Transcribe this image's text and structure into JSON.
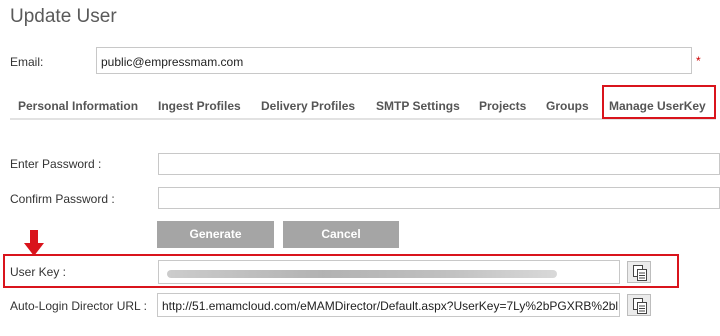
{
  "page": {
    "title": "Update User"
  },
  "email": {
    "label": "Email:",
    "value": "public@empressmam.com",
    "required_mark": "*"
  },
  "tabs": [
    {
      "label": "Personal Information"
    },
    {
      "label": "Ingest Profiles"
    },
    {
      "label": "Delivery Profiles"
    },
    {
      "label": "SMTP Settings"
    },
    {
      "label": "Projects"
    },
    {
      "label": "Groups"
    },
    {
      "label": "Manage UserKey",
      "active": true
    }
  ],
  "userkey_form": {
    "enter_password_label": "Enter Password :",
    "confirm_password_label": "Confirm Password :",
    "generate_label": "Generate",
    "cancel_label": "Cancel",
    "user_key_label": "User Key :",
    "auto_login_label": "Auto-Login Director URL :",
    "auto_login_value": "http://51.emamcloud.com/eMAMDirector/Default.aspx?UserKey=7Ly%2bPGXRB%2bl"
  },
  "icons": {
    "copy": "copy-icon",
    "arrow": "arrow-down-icon"
  },
  "colors": {
    "highlight": "#d9141c",
    "button": "#a5a5a5"
  }
}
